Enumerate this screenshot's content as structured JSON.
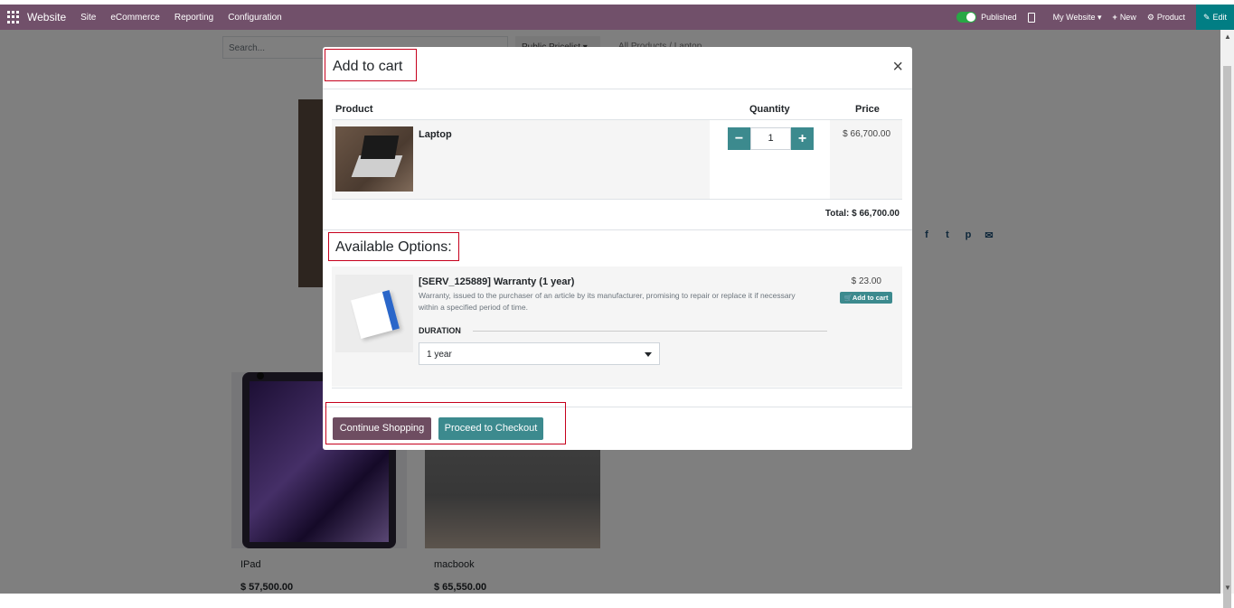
{
  "navbar": {
    "brand": "Website",
    "menu": [
      "Site",
      "eCommerce",
      "Reporting",
      "Configuration"
    ],
    "published_label": "Published",
    "website_label": "My Website ▾",
    "new_label": "New",
    "product_label": "Product",
    "edit_label": "Edit"
  },
  "page": {
    "search_placeholder": "Search...",
    "pricelist": "Public Pricelist ▾",
    "breadcrumb": "All Products  /  Laptop",
    "products": [
      {
        "name": "IPad",
        "price": "$ 57,500.00"
      },
      {
        "name": "macbook",
        "price": "$ 65,550.00"
      }
    ]
  },
  "modal": {
    "title": "Add to cart",
    "close": "×",
    "col_product": "Product",
    "col_quantity": "Quantity",
    "col_price": "Price",
    "product_name": "Laptop",
    "qty_minus": "−",
    "qty_value": "1",
    "qty_plus": "+",
    "product_price": "$ 66,700.00",
    "total": "Total: $ 66,700.00",
    "options_title": "Available Options:",
    "option": {
      "name": "[SERV_125889] Warranty (1 year)",
      "description": "Warranty, issued to the purchaser of an article by its manufacturer, promising to repair or replace it if necessary within a specified period of time.",
      "price": "$ 23.00",
      "add_label": "🛒Add to cart",
      "duration_label": "DURATION",
      "duration_value": "1 year"
    },
    "continue_label": "Continue Shopping",
    "checkout_label": "Proceed to Checkout"
  },
  "colors": {
    "navbar": "#71506a",
    "accent": "#3c8a8e",
    "edit": "#017e84",
    "highlight": "#c6001c"
  }
}
